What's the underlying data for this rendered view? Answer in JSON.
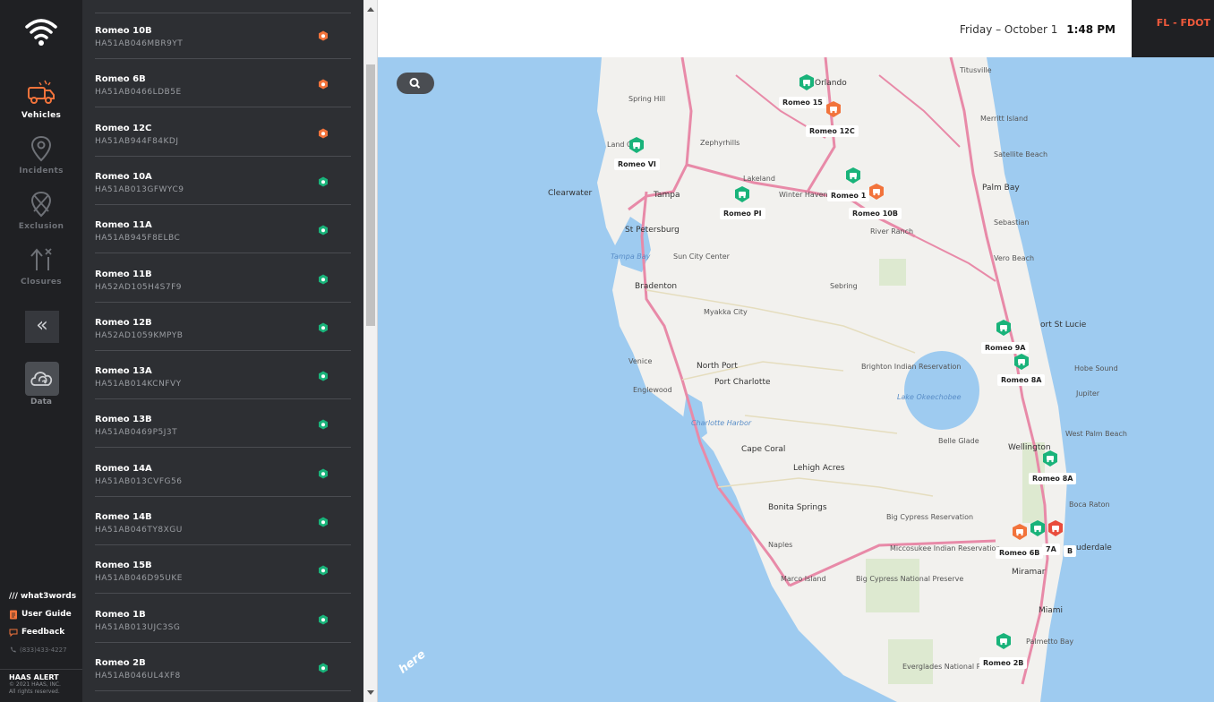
{
  "colors": {
    "accent_orange": "#f2733b",
    "status_green": "#19b37a",
    "rail_bg": "#1f2023",
    "list_bg": "#2d2f33",
    "org_text": "#f05a3c",
    "map_water": "#9ecbf0"
  },
  "rail": {
    "logo_icon": "wifi-signal-icon",
    "items": [
      {
        "label": "Vehicles",
        "icon": "truck-icon",
        "active": true
      },
      {
        "label": "Incidents",
        "icon": "location-pin-icon",
        "active": false
      },
      {
        "label": "Exclusion",
        "icon": "exclusion-pin-icon",
        "active": false
      },
      {
        "label": "Closures",
        "icon": "closure-arrow-icon",
        "active": false
      }
    ],
    "collapse_glyph": "«",
    "data_label": "Data",
    "links": [
      {
        "label": "/// what3words",
        "icon": "what3words-icon"
      },
      {
        "label": "User Guide",
        "icon": "document-icon"
      },
      {
        "label": "Feedback",
        "icon": "chat-icon"
      }
    ],
    "phone": "(833)433-4227",
    "footer_brand": "HAAS ALERT",
    "footer_copy1": "© 2021 HAAS, INC.",
    "footer_copy2": "All rights reserved."
  },
  "vehicles": [
    {
      "name": "Romeo 10B",
      "id": "HA51AB046MBR9YT",
      "status": "orange"
    },
    {
      "name": "Romeo 6B",
      "id": "HA51AB0466LDB5E",
      "status": "orange"
    },
    {
      "name": "Romeo 12C",
      "id": "HA51AB944F84KDJ",
      "status": "orange"
    },
    {
      "name": "Romeo 10A",
      "id": "HA51AB013GFWYC9",
      "status": "green"
    },
    {
      "name": "Romeo 11A",
      "id": "HA51AB945F8ELBC",
      "status": "green"
    },
    {
      "name": "Romeo 11B",
      "id": "HA52AD105H4S7F9",
      "status": "green"
    },
    {
      "name": "Romeo 12B",
      "id": "HA52AD1059KMPYB",
      "status": "green"
    },
    {
      "name": "Romeo 13A",
      "id": "HA51AB014KCNFVY",
      "status": "green"
    },
    {
      "name": "Romeo 13B",
      "id": "HA51AB0469P5J3T",
      "status": "green"
    },
    {
      "name": "Romeo 14A",
      "id": "HA51AB013CVFG56",
      "status": "green"
    },
    {
      "name": "Romeo 14B",
      "id": "HA51AB046TY8XGU",
      "status": "green"
    },
    {
      "name": "Romeo 15B",
      "id": "HA51AB046D95UKE",
      "status": "green"
    },
    {
      "name": "Romeo 1B",
      "id": "HA51AB013UJC3SG",
      "status": "green"
    },
    {
      "name": "Romeo 2B",
      "id": "HA51AB046UL4XF8",
      "status": "green"
    }
  ],
  "topbar": {
    "date": "Friday – October 1",
    "time": "1:48 PM",
    "org": "FL - FDOT"
  },
  "map": {
    "search_icon": "magnifier-icon",
    "attribution": "here",
    "cities": [
      {
        "name": "Orlando",
        "big": true
      },
      {
        "name": "Titusville",
        "big": false
      },
      {
        "name": "Spring Hill",
        "big": false
      },
      {
        "name": "Merritt Island",
        "big": false
      },
      {
        "name": "Zephyrhills",
        "big": false
      },
      {
        "name": "Land O",
        "big": false
      },
      {
        "name": "Satellite Beach",
        "big": false
      },
      {
        "name": "Lakeland",
        "big": false
      },
      {
        "name": "Clearwater",
        "big": true
      },
      {
        "name": "Tampa",
        "big": true
      },
      {
        "name": "Winter Haven",
        "big": false
      },
      {
        "name": "Palm Bay",
        "big": true
      },
      {
        "name": "St Petersburg",
        "big": true
      },
      {
        "name": "River Ranch",
        "big": false
      },
      {
        "name": "Sebastian",
        "big": false
      },
      {
        "name": "Sun City Center",
        "big": false
      },
      {
        "name": "Tampa Bay",
        "big": false,
        "water": true
      },
      {
        "name": "Vero Beach",
        "big": false
      },
      {
        "name": "Bradenton",
        "big": true
      },
      {
        "name": "Sebring",
        "big": false
      },
      {
        "name": "Myakka City",
        "big": false
      },
      {
        "name": "ort St Lucie",
        "big": true
      },
      {
        "name": "Venice",
        "big": false
      },
      {
        "name": "North Port",
        "big": true
      },
      {
        "name": "Brighton Indian Reservation",
        "big": false
      },
      {
        "name": "Hobe Sound",
        "big": false
      },
      {
        "name": "Englewood",
        "big": false
      },
      {
        "name": "Port Charlotte",
        "big": true
      },
      {
        "name": "Lake Okeechobee",
        "big": false,
        "water": true
      },
      {
        "name": "Jupiter",
        "big": false
      },
      {
        "name": "Charlotte Harbor",
        "big": false,
        "water": true
      },
      {
        "name": "West Palm Beach",
        "big": false
      },
      {
        "name": "Belle Glade",
        "big": false
      },
      {
        "name": "Cape Coral",
        "big": true
      },
      {
        "name": "Wellington",
        "big": true
      },
      {
        "name": "Lehigh Acres",
        "big": true
      },
      {
        "name": "Boca Raton",
        "big": false
      },
      {
        "name": "Bonita Springs",
        "big": true
      },
      {
        "name": "Big Cypress Reservation",
        "big": false
      },
      {
        "name": "Naples",
        "big": false
      },
      {
        "name": "Miccosukee Indian Reservation",
        "big": false
      },
      {
        "name": "uderdale",
        "big": true
      },
      {
        "name": "Marco Island",
        "big": false
      },
      {
        "name": "Big Cypress National Preserve",
        "big": false
      },
      {
        "name": "Miramar",
        "big": true
      },
      {
        "name": "Miami",
        "big": true
      },
      {
        "name": "Palmetto Bay",
        "big": false
      },
      {
        "name": "Everglades National Park",
        "big": false
      }
    ],
    "vehicle_labels": [
      "Romeo 15",
      "Romeo 12C",
      "Romeo VI",
      "Romeo PI",
      "Romeo 1",
      "Romeo 10B",
      "Romeo 9A",
      "Romeo 8A",
      "Romeo 8A",
      "Romeo 6B",
      "7A",
      "B",
      "Romeo 2B"
    ]
  }
}
